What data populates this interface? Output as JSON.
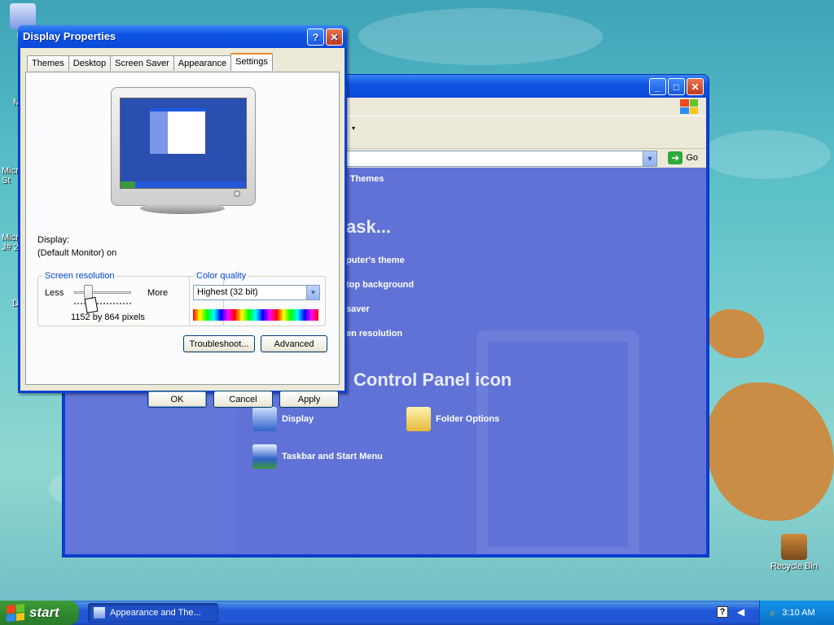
{
  "desktop": {
    "icons": [
      {
        "label": "My",
        "name": "my-computer"
      },
      {
        "label": "Recycle Bin",
        "name": "recycle-bin"
      }
    ],
    "partial_labels": [
      "M",
      "Micr",
      "St",
      "Micr",
      "J# 2",
      "D"
    ]
  },
  "control_panel": {
    "category_heading": "d Themes",
    "task_title": "ask...",
    "tasks": [
      "puter's theme",
      "top background",
      "saver",
      "en resolution"
    ],
    "pick_title": "Control Panel icon",
    "items": [
      "Display",
      "Folder Options",
      "Taskbar and Start Menu"
    ],
    "address_go": "Go"
  },
  "dialog": {
    "title": "Display Properties",
    "tabs": [
      "Themes",
      "Desktop",
      "Screen Saver",
      "Appearance",
      "Settings"
    ],
    "active_tab": "Settings",
    "display_label": "Display:",
    "display_value": "(Default Monitor) on",
    "resolution": {
      "group_title": "Screen resolution",
      "less": "Less",
      "more": "More",
      "value": "1152 by 864 pixels",
      "slider_level": 0.25
    },
    "color": {
      "group_title": "Color quality",
      "selected": "Highest (32 bit)"
    },
    "buttons": {
      "troubleshoot": "Troubleshoot...",
      "advanced": "Advanced",
      "ok": "OK",
      "cancel": "Cancel",
      "apply": "Apply"
    }
  },
  "taskbar": {
    "start": "start",
    "task_item": "Appearance and The...",
    "clock": "3:10 AM"
  }
}
